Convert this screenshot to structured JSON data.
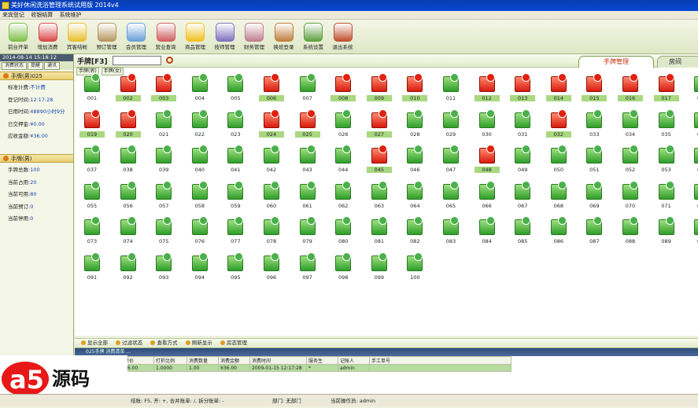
{
  "app": {
    "title": "美好休闲洗浴管理系统试用版 2014v4"
  },
  "menu": [
    "来宾登记",
    "收银结算",
    "系统维护"
  ],
  "toolbar": [
    {
      "label": "前台开单",
      "icon": "user-icon",
      "color": "#7fc04a"
    },
    {
      "label": "增加消费",
      "icon": "add-icon",
      "color": "#d94a4a"
    },
    {
      "label": "宾客结帐",
      "icon": "arrow-icon",
      "color": "#e8c030"
    },
    {
      "label": "预订管理",
      "icon": "clock-icon",
      "color": "#b89860"
    },
    {
      "label": "会员管理",
      "icon": "members-icon",
      "color": "#6aa0d8"
    },
    {
      "label": "营业查询",
      "icon": "query-icon",
      "color": "#d06060"
    },
    {
      "label": "商品管理",
      "icon": "star-icon",
      "color": "#f0c020"
    },
    {
      "label": "技师管理",
      "icon": "technician-icon",
      "color": "#8070c0"
    },
    {
      "label": "财务管理",
      "icon": "finance-icon",
      "color": "#c08090"
    },
    {
      "label": "换班登录",
      "icon": "door-icon",
      "color": "#c08040"
    },
    {
      "label": "系统设置",
      "icon": "gear-icon",
      "color": "#60a040"
    },
    {
      "label": "退出系统",
      "icon": "exit-icon",
      "color": "#c05030"
    }
  ],
  "left": {
    "clock": "2014-08-14 15:18:12",
    "tabs": [
      "消费状态",
      "提醒",
      "通讯"
    ],
    "section1": {
      "title": "手牌(男)025",
      "rows": [
        {
          "k": "标准计费:",
          "v": "不计费"
        },
        {
          "k": "登记时间:",
          "v": "12:17:28"
        },
        {
          "k": "已用时间:",
          "v": "48890小时9分"
        },
        {
          "k": "已交押金:",
          "v": "¥0.00"
        },
        {
          "k": "应收金额:",
          "v": "¥36.00"
        }
      ]
    },
    "section2": {
      "title": "手牌(男)",
      "rows": [
        {
          "k": "手牌总数:",
          "v": "100"
        },
        {
          "k": "当前占用:",
          "v": "20"
        },
        {
          "k": "当前可用:",
          "v": "80"
        },
        {
          "k": "当前预订:",
          "v": "0"
        },
        {
          "k": "当前停用:",
          "v": "0"
        }
      ]
    }
  },
  "main": {
    "title": "手牌[F3]",
    "search_placeholder": "",
    "tabs": [
      "手牌管理",
      "房间"
    ],
    "subtabs": [
      "手牌(男)",
      "手牌(女)"
    ],
    "occupied": [
      "002",
      "003",
      "006",
      "008",
      "009",
      "010",
      "012",
      "013",
      "014",
      "015",
      "016",
      "017",
      "019",
      "020",
      "024",
      "025",
      "027",
      "032",
      "045",
      "048"
    ],
    "total": 100,
    "bottom_buttons": [
      "显示全部",
      "过滤状态",
      "查看方式",
      "刷新显示",
      "房态管理"
    ]
  },
  "bottom": {
    "header": "025手牌  消费清单  ...  ",
    "columns": [
      "单价",
      "打折比例",
      "消费数量",
      "消费金额",
      "消费时间",
      "服务生",
      "记账人",
      "手工单号"
    ],
    "row": [
      "36.00",
      "1.0000",
      "1.00",
      "¥36.00",
      "2009-01-15 12:17:28",
      "*",
      "admin",
      ""
    ]
  },
  "status": {
    "shortcuts": "结账: F5, 开: +, 合并账单: /, 拆分账单: -",
    "department": "部门: 无部门",
    "operator": "当前操作员: admin"
  },
  "logo": {
    "brand": "a5源码",
    "url": "admin5.com"
  }
}
